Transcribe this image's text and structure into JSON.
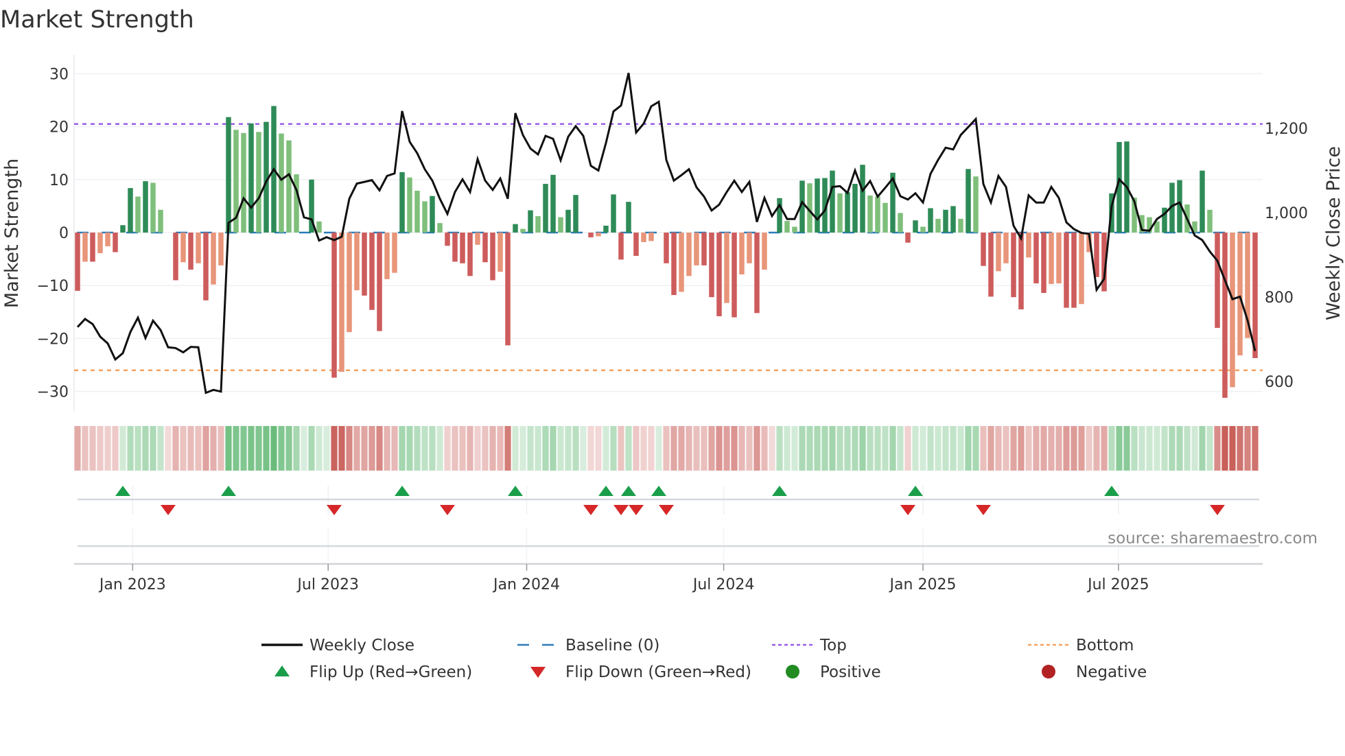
{
  "chart_data": {
    "type": "bar",
    "title": "Market Strength",
    "ylabel": "Market Strength",
    "y2label": "Weekly Close Price",
    "ylim": [
      -33,
      34
    ],
    "y2lim": [
      560,
      1330
    ],
    "yticks": [
      30,
      20,
      10,
      0,
      -10,
      -20,
      -30
    ],
    "yticklabels": [
      "30",
      "20",
      "10",
      "0",
      "−10",
      "−20",
      "−30"
    ],
    "y2ticks": [
      1200,
      1000,
      800,
      600
    ],
    "y2ticklabels": [
      "1,200",
      "1,000",
      "800",
      "600"
    ],
    "xticks": [
      {
        "label": "Jan 2023",
        "week": 7.3
      },
      {
        "label": "Jul 2023",
        "week": 33.2
      },
      {
        "label": "Jan 2024",
        "week": 59.5
      },
      {
        "label": "Jul 2024",
        "week": 85.6
      },
      {
        "label": "Jan 2025",
        "week": 112.0
      },
      {
        "label": "Jul 2025",
        "week": 137.9
      }
    ],
    "top_level": 20.5,
    "bottom_level": -26.0,
    "baseline": 0,
    "strength": [
      -11.0,
      -5.5,
      -5.5,
      -3.9,
      -2.6,
      -3.7,
      1.4,
      8.4,
      6.8,
      9.7,
      9.4,
      4.3,
      -0.1,
      -9.0,
      -5.6,
      -7.0,
      -5.8,
      -12.8,
      -9.8,
      -6.2,
      21.8,
      19.4,
      18.8,
      20.6,
      19.0,
      20.9,
      23.9,
      18.7,
      17.4,
      11.0,
      0.1,
      10.0,
      2.1,
      0.1,
      -27.4,
      -26.3,
      -18.8,
      -10.9,
      -11.9,
      -14.6,
      -18.6,
      -8.8,
      -7.6,
      11.4,
      10.4,
      7.9,
      5.9,
      6.9,
      1.8,
      -2.5,
      -5.5,
      -5.8,
      -8.2,
      -2.3,
      -5.6,
      -9.0,
      -7.4,
      -21.3,
      1.6,
      0.7,
      4.2,
      3.1,
      9.2,
      10.9,
      2.9,
      4.3,
      7.1,
      0.1,
      -0.9,
      -0.7,
      1.3,
      7.2,
      -5.1,
      5.8,
      -4.4,
      -1.8,
      -1.6,
      0.1,
      -5.8,
      -11.8,
      -11.2,
      -8.2,
      -6.2,
      -6.2,
      -12.2,
      -15.8,
      -13.3,
      -16.0,
      -7.9,
      -5.8,
      -15.2,
      -7.0,
      -0.1,
      6.5,
      2.2,
      1.1,
      9.8,
      9.3,
      10.2,
      10.3,
      11.7,
      7.4,
      7.6,
      9.2,
      12.8,
      7.0,
      6.8,
      5.6,
      11.3,
      3.7,
      -1.9,
      2.3,
      1.1,
      4.6,
      2.6,
      4.3,
      5.0,
      2.6,
      12.0,
      10.6,
      -6.3,
      -12.1,
      -7.3,
      -5.8,
      -12.2,
      -14.5,
      -4.7,
      -9.6,
      -11.4,
      -9.7,
      -9.6,
      -14.2,
      -14.2,
      -13.5,
      -3.7,
      -8.4,
      -11.1,
      7.4,
      17.1,
      17.2,
      6.6,
      3.3,
      2.9,
      2.1,
      4.7,
      9.4,
      9.9,
      5.3,
      2.1,
      11.7,
      4.3,
      -18.0,
      -31.2,
      -29.2,
      -23.2,
      -19.9,
      -23.7
    ],
    "weekly_close": [
      729,
      748,
      736,
      706,
      690,
      652,
      667,
      717,
      751,
      703,
      744,
      722,
      681,
      679,
      669,
      682,
      681,
      573,
      580,
      576,
      976,
      988,
      1034,
      1012,
      1034,
      1074,
      1103,
      1078,
      1091,
      1054,
      989,
      984,
      934,
      942,
      935,
      943,
      1033,
      1069,
      1073,
      1077,
      1053,
      1087,
      1093,
      1241,
      1168,
      1141,
      1103,
      1076,
      1033,
      997,
      1049,
      1079,
      1049,
      1127,
      1076,
      1054,
      1081,
      1033,
      1236,
      1184,
      1152,
      1138,
      1182,
      1175,
      1124,
      1180,
      1205,
      1182,
      1111,
      1100,
      1165,
      1240,
      1254,
      1331,
      1190,
      1211,
      1252,
      1263,
      1125,
      1076,
      1089,
      1103,
      1060,
      1038,
      1005,
      1019,
      1049,
      1076,
      1049,
      1073,
      978,
      1035,
      992,
      1018,
      985,
      985,
      1025,
      1004,
      984,
      1005,
      1061,
      1063,
      1047,
      1100,
      1052,
      1075,
      1038,
      1059,
      1081,
      1039,
      1031,
      1046,
      1024,
      1092,
      1125,
      1154,
      1150,
      1184,
      1203,
      1222,
      1068,
      1024,
      1087,
      1061,
      969,
      939,
      1041,
      1024,
      1024,
      1061,
      1035,
      977,
      961,
      952,
      950,
      817,
      843,
      1016,
      1079,
      1061,
      1027,
      959,
      957,
      985,
      997,
      1016,
      1024,
      985,
      946,
      935,
      908,
      886,
      840,
      795,
      801,
      745,
      672
    ],
    "legend": {
      "placement": "bottom",
      "items": [
        {
          "key": "close",
          "label": "Weekly Close"
        },
        {
          "key": "baseline",
          "label": "Baseline (0)"
        },
        {
          "key": "top",
          "label": "Top"
        },
        {
          "key": "bottom",
          "label": "Bottom"
        },
        {
          "key": "flip_up",
          "label": "Flip Up (Red→Green)"
        },
        {
          "key": "flip_down",
          "label": "Flip Down (Green→Red)"
        },
        {
          "key": "positive",
          "label": "Positive"
        },
        {
          "key": "negative",
          "label": "Negative"
        }
      ]
    },
    "source": "source: sharemaestro.com",
    "colors": {
      "pos_strong": "#2e8b57",
      "pos_weak": "#7fbf7b",
      "neg_strong": "#cd5c5c",
      "neg_weak": "#e8957a",
      "close": "#111111",
      "baseline": "#2b7bb9",
      "top": "#9b5de5",
      "bottom": "#f4a261",
      "flip_up": "#1a9e4a",
      "flip_down": "#d62728",
      "positive": "#228b22",
      "negative": "#b22222"
    }
  }
}
